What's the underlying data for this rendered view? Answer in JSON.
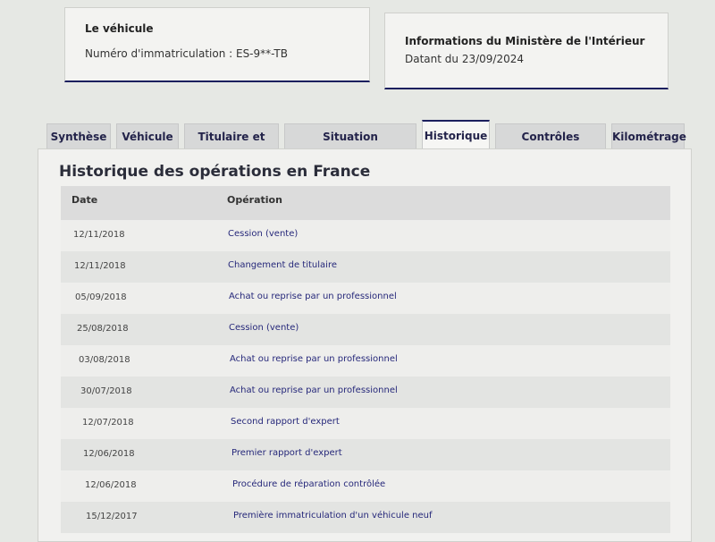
{
  "vehicle_card": {
    "title": "Le véhicule",
    "plate_line": "Numéro d'immatriculation : ES-9**-TB"
  },
  "ministry_card": {
    "title": "Informations du Ministère de l'Intérieur",
    "date_line": "Datant du 23/09/2024"
  },
  "tabs": [
    {
      "label": "Synthèse"
    },
    {
      "label": "Véhicule"
    },
    {
      "label": "Titulaire et Titre"
    },
    {
      "label": "Situation administrative"
    },
    {
      "label": "Historique",
      "active": true
    },
    {
      "label": "Contrôles techniques"
    },
    {
      "label": "Kilométrage"
    }
  ],
  "history": {
    "title": "Historique des opérations en France",
    "columns": {
      "date": "Date",
      "operation": "Opération"
    },
    "rows": [
      {
        "date": "12/11/2018",
        "operation": "Cession (vente)"
      },
      {
        "date": "12/11/2018",
        "operation": "Changement de titulaire"
      },
      {
        "date": "05/09/2018",
        "operation": "Achat ou reprise par un professionnel"
      },
      {
        "date": "25/08/2018",
        "operation": "Cession (vente)"
      },
      {
        "date": "03/08/2018",
        "operation": "Achat ou reprise par un professionnel"
      },
      {
        "date": "30/07/2018",
        "operation": "Achat ou reprise par un professionnel"
      },
      {
        "date": "12/07/2018",
        "operation": "Second rapport d'expert"
      },
      {
        "date": "12/06/2018",
        "operation": "Premier rapport d'expert"
      },
      {
        "date": "12/06/2018",
        "operation": "Procédure de réparation contrôlée"
      },
      {
        "date": "15/12/2017",
        "operation": "Première immatriculation d'un véhicule neuf"
      }
    ]
  },
  "colors": {
    "accent": "#1b1f5e",
    "link": "#26287a"
  }
}
